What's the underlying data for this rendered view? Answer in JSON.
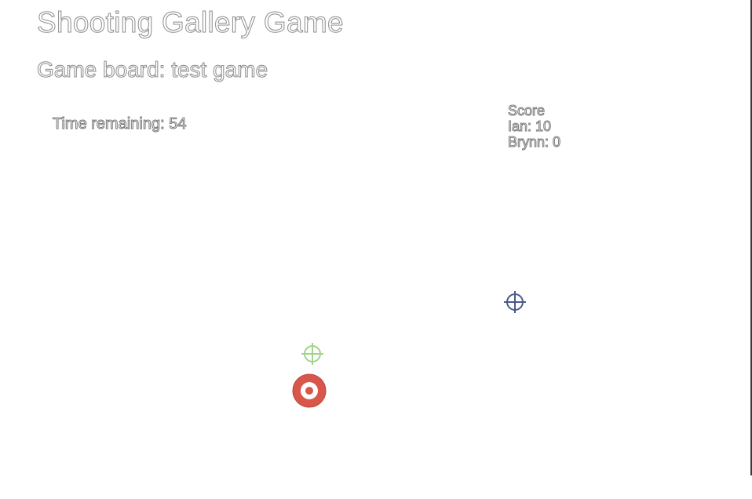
{
  "page": {
    "title": "Shooting Gallery Game"
  },
  "board": {
    "label": "Game board: test game"
  },
  "timer": {
    "text": "Time remaining: 54"
  },
  "scoreboard": {
    "heading": "Score",
    "players": [
      {
        "text": "Ian: 10"
      },
      {
        "text": "Brynn: 0"
      }
    ]
  },
  "sprites": {
    "crosshair_blue": {
      "icon": "crosshair-icon",
      "color": "#4a5a8a"
    },
    "crosshair_green": {
      "icon": "crosshair-icon",
      "color": "#9fd48a"
    },
    "target": {
      "icon": "bullseye-target-icon",
      "outer_color": "#d9574a",
      "inner_color": "#ffffff"
    }
  }
}
